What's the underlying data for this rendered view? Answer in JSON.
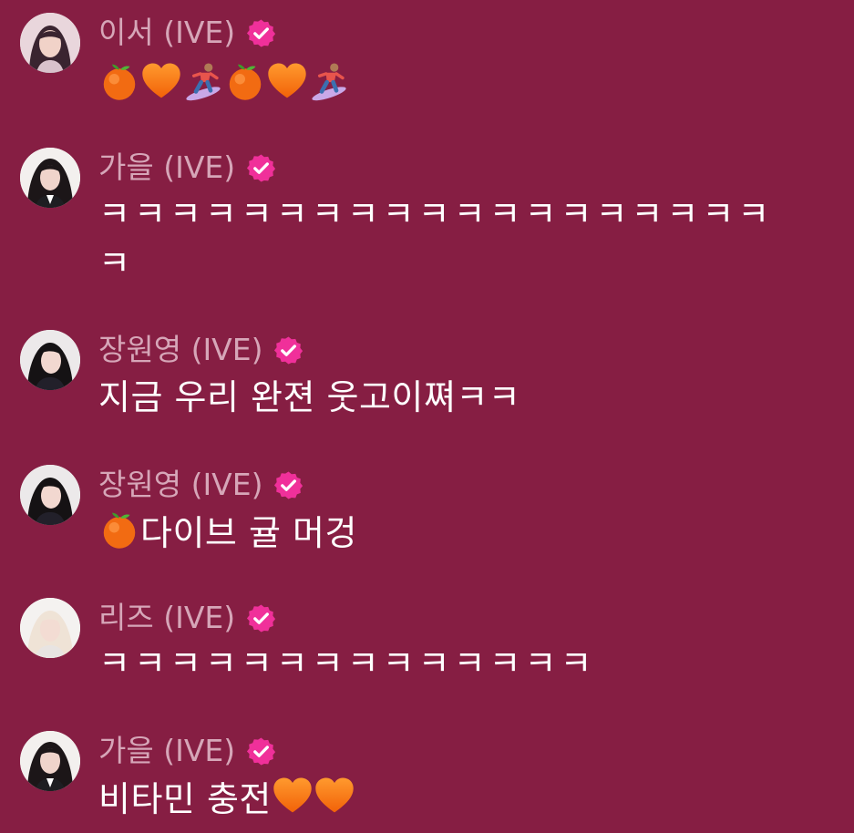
{
  "messages": [
    {
      "author": "이서 (IVE)",
      "verified": true,
      "text": "",
      "emojis": [
        "tangerine-emoji",
        "orange-heart-emoji",
        "snowboarder-emoji",
        "tangerine-emoji",
        "orange-heart-emoji",
        "snowboarder-emoji"
      ],
      "avatar": "avatar-leeseo"
    },
    {
      "author": "가을 (IVE)",
      "verified": true,
      "text": "ㅋㅋㅋㅋㅋㅋㅋㅋㅋㅋㅋㅋㅋㅋㅋㅋㅋㅋㅋㅋ",
      "avatar": "avatar-gaeul"
    },
    {
      "author": "장원영 (IVE)",
      "verified": true,
      "text": "지금 우리 완젼 웃고이쪄ㅋㅋ",
      "avatar": "avatar-wonyoung"
    },
    {
      "author": "장원영 (IVE)",
      "verified": true,
      "text": "다이브 귤 머겅",
      "lead_emoji": "tangerine-emoji",
      "avatar": "avatar-wonyoung"
    },
    {
      "author": "리즈 (IVE)",
      "verified": true,
      "text": "ㅋㅋㅋㅋㅋㅋㅋㅋㅋㅋㅋㅋㅋㅋ",
      "avatar": "avatar-liz"
    },
    {
      "author": "가을 (IVE)",
      "verified": true,
      "text": "비타민 충전",
      "trail_emojis": [
        "orange-heart-emoji",
        "orange-heart-emoji"
      ],
      "avatar": "avatar-gaeul"
    }
  ],
  "colors": {
    "background": "#861e43",
    "name": "#d6a6b8",
    "message_text": "#ffffff",
    "badge": "#f0309a"
  }
}
